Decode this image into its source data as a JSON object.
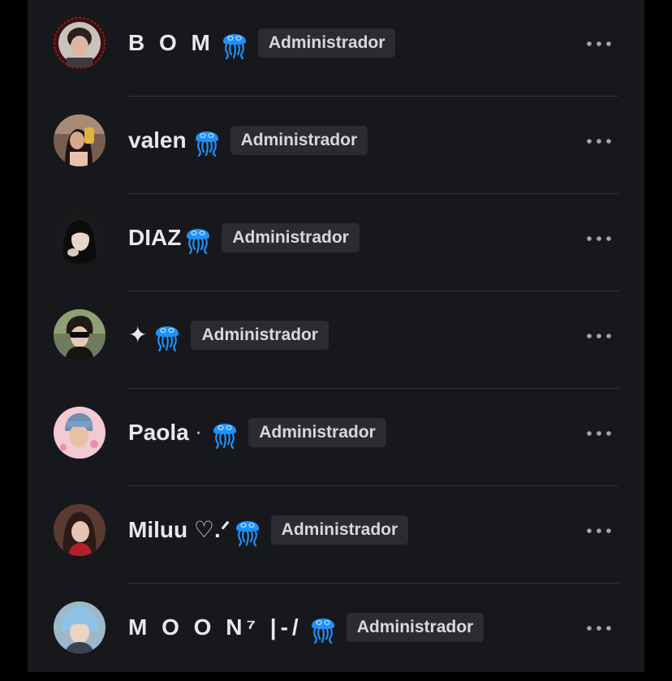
{
  "members": [
    {
      "name": "B O M",
      "badge": "Administrador"
    },
    {
      "name": "valen",
      "badge": "Administrador"
    },
    {
      "name": "DIAZ",
      "badge": "Administrador"
    },
    {
      "name": "✦",
      "badge": "Administrador"
    },
    {
      "name": "Paola",
      "name_suffix": "⋆",
      "badge": "Administrador"
    },
    {
      "name": "Miluu ♡.ᐟ",
      "badge": "Administrador"
    },
    {
      "name": "M O O N⁷ |-/",
      "badge": "Administrador"
    }
  ],
  "colors": {
    "panel_bg": "#17181b",
    "badge_bg": "#2b2c31",
    "text": "#e8e8ea",
    "jellyfish": "#1e90ff"
  },
  "icons": {
    "name_emoji": "jellyfish-icon",
    "row_menu": "more-horizontal-icon"
  }
}
